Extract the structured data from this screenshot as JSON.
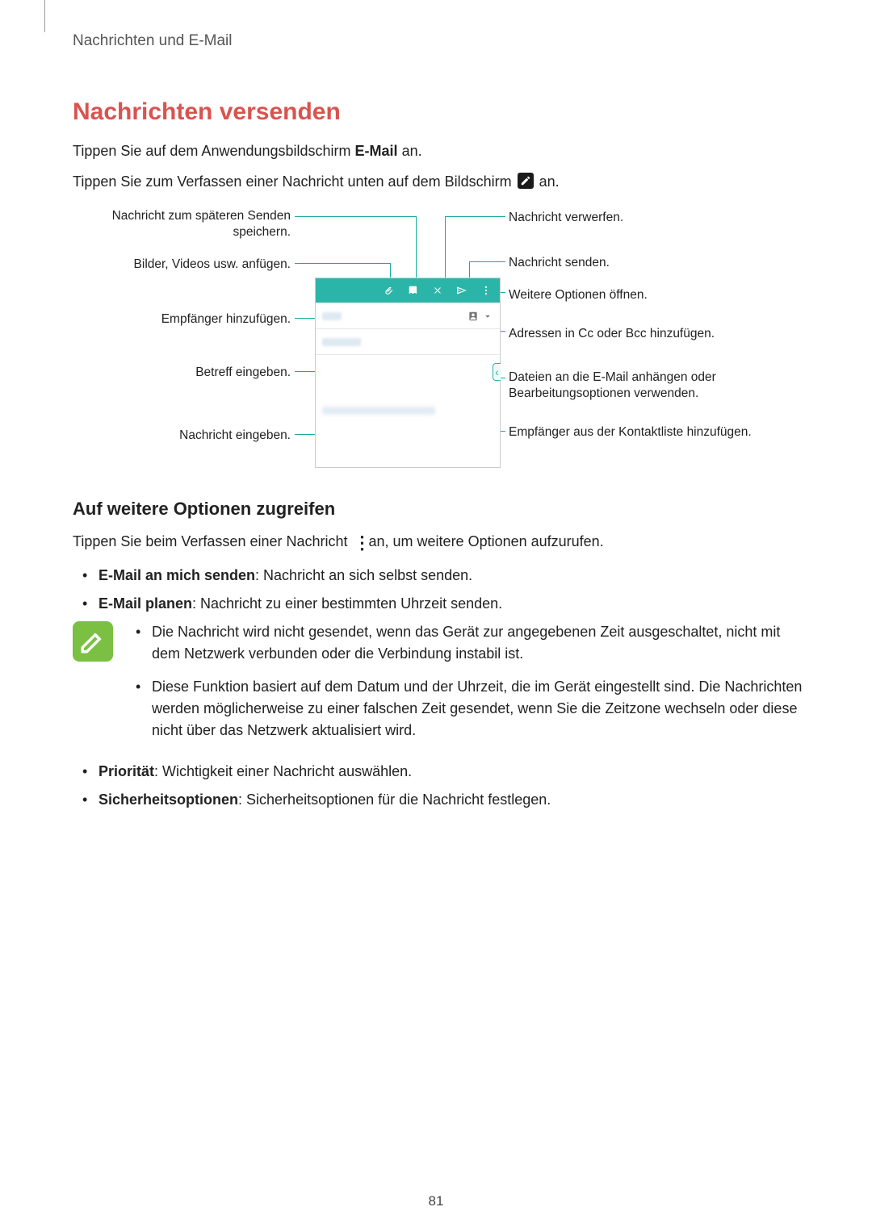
{
  "breadcrumb": "Nachrichten und E-Mail",
  "title": "Nachrichten versenden",
  "para1_pre": "Tippen Sie auf dem Anwendungsbildschirm ",
  "para1_bold": "E-Mail",
  "para1_post": " an.",
  "para2_pre": "Tippen Sie zum Verfassen einer Nachricht unten auf dem Bildschirm ",
  "para2_post": " an.",
  "callouts": {
    "left": {
      "save": "Nachricht zum späteren Senden speichern.",
      "attach": "Bilder, Videos usw. anfügen.",
      "recipient": "Empfänger hinzufügen.",
      "subject": "Betreff eingeben.",
      "body": "Nachricht eingeben."
    },
    "right": {
      "discard": "Nachricht verwerfen.",
      "send": "Nachricht senden.",
      "more": "Weitere Optionen öffnen.",
      "ccbcc": "Adressen in Cc oder Bcc hinzufügen.",
      "sidebar": "Dateien an die E-Mail anhängen oder Bearbeitungsoptionen verwenden.",
      "contacts": "Empfänger aus der Kontaktliste hinzufügen."
    }
  },
  "subheading": "Auf weitere Optionen zugreifen",
  "sub_pre": "Tippen Sie beim Verfassen einer Nachricht ",
  "sub_post": " an, um weitere Optionen aufzurufen.",
  "options": {
    "send_self_bold": "E-Mail an mich senden",
    "send_self_rest": ": Nachricht an sich selbst senden.",
    "plan_bold": "E-Mail planen",
    "plan_rest": ": Nachricht zu einer bestimmten Uhrzeit senden.",
    "priority_bold": "Priorität",
    "priority_rest": ": Wichtigkeit einer Nachricht auswählen.",
    "security_bold": "Sicherheitsoptionen",
    "security_rest": ": Sicherheitsoptionen für die Nachricht festlegen."
  },
  "notes": {
    "n1": "Die Nachricht wird nicht gesendet, wenn das Gerät zur angegebenen Zeit ausgeschaltet, nicht mit dem Netzwerk verbunden oder die Verbindung instabil ist.",
    "n2": "Diese Funktion basiert auf dem Datum und der Uhrzeit, die im Gerät eingestellt sind. Die Nachrichten werden möglicherweise zu einer falschen Zeit gesendet, wenn Sie die Zeitzone wechseln oder diese nicht über das Netzwerk aktualisiert wird."
  },
  "page_number": "81"
}
